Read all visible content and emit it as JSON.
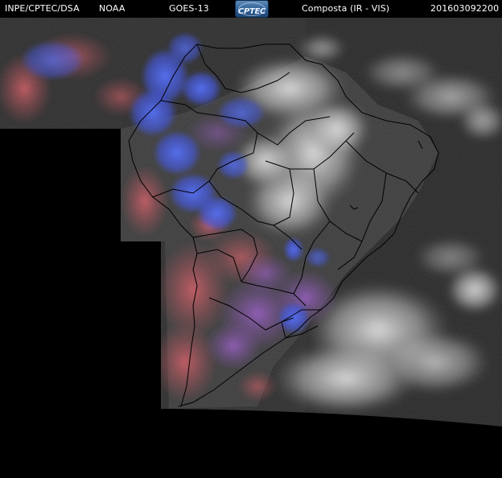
{
  "header": {
    "source": "INPE/CPTEC/DSA",
    "agency": "NOAA",
    "satellite": "GOES-13",
    "logo_text": "CPTEC",
    "product": "Composta (IR - VIS)",
    "datetime": "201603092200"
  },
  "legend_colors": {
    "cold_cloud_blue": "#4a63ff",
    "warm_surface_red": "#d2555c",
    "violet_transition": "#9a5ac8",
    "visible_cloud_gray": "#cfcfcf",
    "background": "#000000"
  }
}
